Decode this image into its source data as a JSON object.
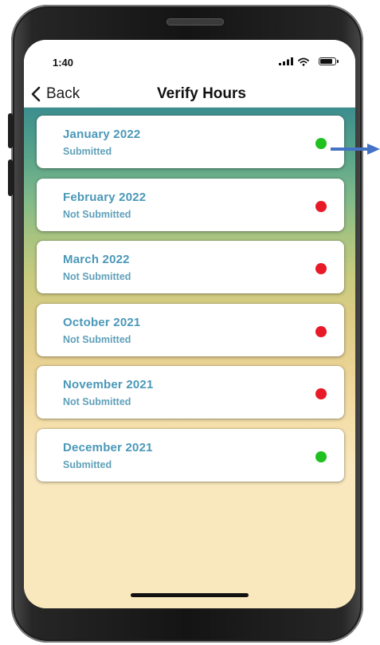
{
  "status_bar": {
    "time": "1:40"
  },
  "nav": {
    "back_label": "Back",
    "title": "Verify Hours"
  },
  "colors": {
    "submitted": "#1fc01f",
    "not_submitted": "#e81a27",
    "text_primary": "#4a98b7",
    "annotation_arrow": "#4472c4"
  },
  "months": [
    {
      "label": "January 2022",
      "status": "Submitted",
      "state": "submitted"
    },
    {
      "label": "February 2022",
      "status": "Not Submitted",
      "state": "not_submitted"
    },
    {
      "label": "March 2022",
      "status": "Not Submitted",
      "state": "not_submitted"
    },
    {
      "label": "October 2021",
      "status": "Not Submitted",
      "state": "not_submitted"
    },
    {
      "label": "November 2021",
      "status": "Not Submitted",
      "state": "not_submitted"
    },
    {
      "label": "December 2021",
      "status": "Submitted",
      "state": "submitted"
    }
  ],
  "icons": {
    "back": "chevron-left-icon",
    "signal": "cellular-signal-icon",
    "wifi": "wifi-icon",
    "battery": "battery-icon",
    "status": "status-dot-icon",
    "annotation": "arrow-right-icon"
  }
}
